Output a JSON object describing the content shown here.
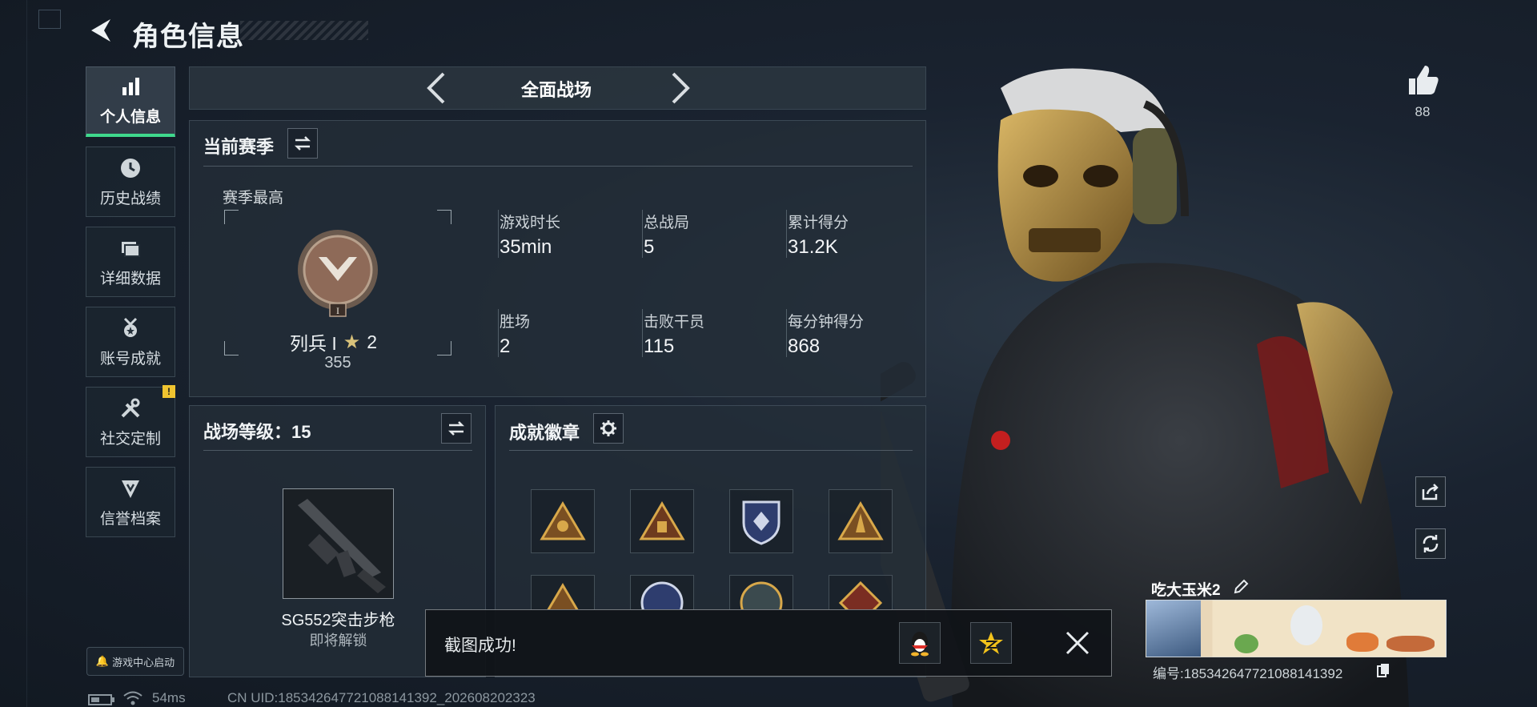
{
  "header": {
    "title": "角色信息"
  },
  "nav": {
    "items": [
      {
        "label": "个人信息",
        "icon": "bar-chart-icon",
        "active": true
      },
      {
        "label": "历史战绩",
        "icon": "clock-icon",
        "active": false
      },
      {
        "label": "详细数据",
        "icon": "folder-icon",
        "active": false
      },
      {
        "label": "账号成就",
        "icon": "medal-icon",
        "active": false
      },
      {
        "label": "社交定制",
        "icon": "tools-icon",
        "active": false,
        "badge": "!"
      },
      {
        "label": "信誉档案",
        "icon": "shield-icon",
        "active": false
      }
    ],
    "launch_label": "游戏中心启动"
  },
  "mode": {
    "label": "全面战场"
  },
  "season": {
    "title": "当前赛季",
    "best_label": "赛季最高",
    "rank_name": "列兵 I",
    "rank_stars": "2",
    "rank_points": "355",
    "rank_tier": "I",
    "stats": [
      {
        "label": "游戏时长",
        "value": "35min"
      },
      {
        "label": "总战局",
        "value": "5"
      },
      {
        "label": "累计得分",
        "value": "31.2K"
      },
      {
        "label": "胜场",
        "value": "2"
      },
      {
        "label": "击败干员",
        "value": "115"
      },
      {
        "label": "每分钟得分",
        "value": "868"
      }
    ]
  },
  "battle_level": {
    "title": "战场等级：15",
    "weapon_name": "SG552突击步枪",
    "weapon_status": "即将解锁"
  },
  "achievements": {
    "title": "成就徽章",
    "badges": [
      "triangle-badge-icon",
      "triangle-badge-icon",
      "shield-badge-icon",
      "rocket-badge-icon",
      "triangle-badge-icon",
      "round-badge-icon",
      "round-badge-icon",
      "diamond-badge-icon"
    ]
  },
  "toast": {
    "text": "截图成功!"
  },
  "profile": {
    "likes": "88",
    "name": "吃大玉米2",
    "id_text": "编号:18534264772108814139​2"
  },
  "status": {
    "ping": "54ms",
    "uid": "CN UID:185342647721088141392_202608202323"
  },
  "colors": {
    "accent": "#3fd98d",
    "warning": "#f0c430",
    "gold": "#c9a045"
  }
}
